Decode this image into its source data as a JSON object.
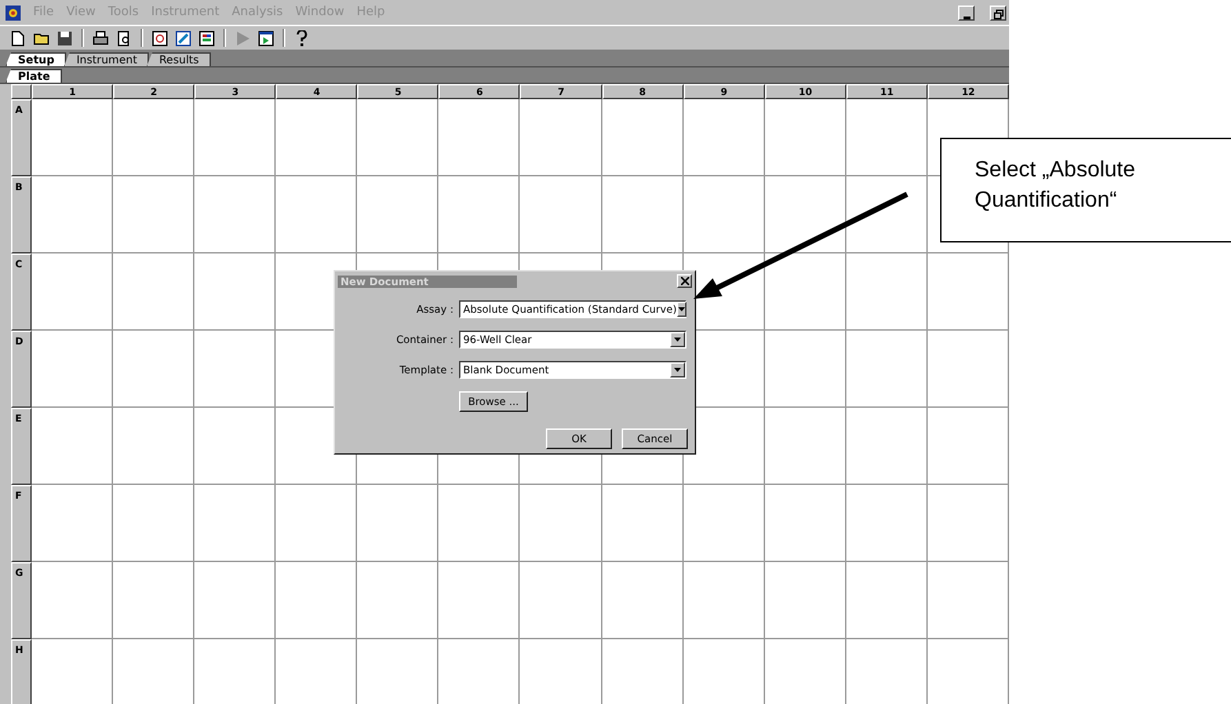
{
  "menu": [
    "File",
    "View",
    "Tools",
    "Instrument",
    "Analysis",
    "Window",
    "Help"
  ],
  "tabs": [
    {
      "label": "Setup",
      "selected": true
    },
    {
      "label": "Instrument",
      "selected": false
    },
    {
      "label": "Results",
      "selected": false
    }
  ],
  "subtabs": [
    {
      "label": "Plate",
      "selected": true
    }
  ],
  "plate": {
    "columns": [
      "1",
      "2",
      "3",
      "4",
      "5",
      "6",
      "7",
      "8",
      "9",
      "10",
      "11",
      "12"
    ],
    "rows": [
      "A",
      "B",
      "C",
      "D",
      "E",
      "F",
      "G",
      "H"
    ]
  },
  "dialog": {
    "title": "New Document",
    "fields": [
      {
        "label": "Assay :",
        "value": "Absolute Quantification (Standard Curve)"
      },
      {
        "label": "Container :",
        "value": "96-Well Clear"
      },
      {
        "label": "Template :",
        "value": "Blank Document"
      }
    ],
    "browse": "Browse ...",
    "buttons": [
      "OK",
      "Cancel"
    ]
  },
  "callout": "Select „Absolute Quantification“"
}
